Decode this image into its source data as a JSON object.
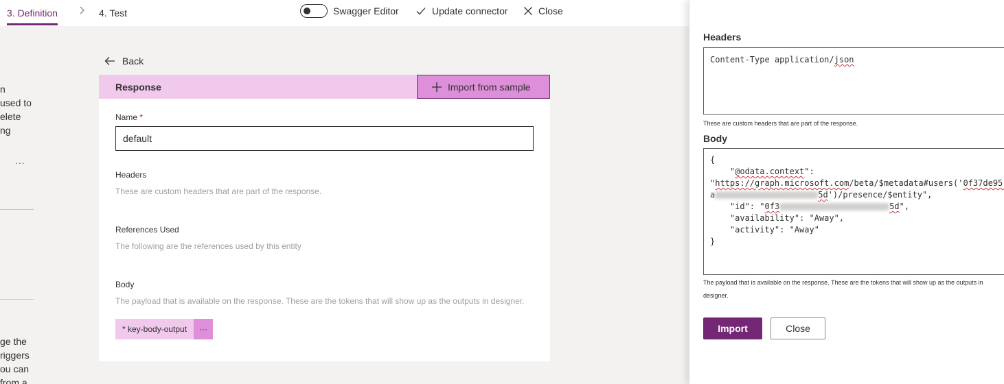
{
  "steps": {
    "active_label": "3. Definition",
    "next_label": "4. Test"
  },
  "toolbar": {
    "swagger_label": "Swagger Editor",
    "update_label": "Update connector",
    "close_label": "Close"
  },
  "sidebar": {
    "fragments": [
      "n",
      "used to",
      "elete",
      "ng",
      "ge the",
      "riggers",
      "ou can",
      "from a"
    ],
    "more_label": "..."
  },
  "back_label": "Back",
  "response_card": {
    "title": "Response",
    "import_label": "Import from sample",
    "name_label": "Name",
    "required_marker": "*",
    "name_value": "default",
    "headers_label": "Headers",
    "headers_help": "These are custom headers that are part of the response.",
    "references_label": "References Used",
    "references_help": "The following are the references used by this entity",
    "body_label": "Body",
    "body_help": "The payload that is available on the response. These are the tokens that will show up as the outputs in designer.",
    "token_label": "* key-body-output",
    "token_more": "···"
  },
  "panel": {
    "headers_label": "Headers",
    "headers_value_prefix": "Content-Type application/",
    "headers_value_json": "json",
    "headers_help": "These are custom headers that are part of the response.",
    "body_label": "Body",
    "body_lines": {
      "l1": "{",
      "l2_pre": "    \"",
      "l2_key": "@odata.context",
      "l2_post": "\":",
      "l3_pre": "\"",
      "l3_url": "https://graph.microsoft.com",
      "l3_mid": "/beta/$metadata#users('",
      "l3_id": "0f37de95-",
      "l4_a": "a",
      "l4_end": "5d",
      "l4_post": "')/presence/$entity\",",
      "l5_pre": "    \"id\": \"",
      "l5_id": "0f3",
      "l5_end": "5d",
      "l5_post": "\",",
      "l6": "    \"availability\": \"Away\",",
      "l7": "    \"activity\": \"Away\"",
      "l8": "}"
    },
    "body_help_line1": "The payload that is available on the response. These are the tokens that will show up as the outputs in",
    "body_help_line2": "designer.",
    "import_button": "Import",
    "close_button": "Close"
  },
  "colors": {
    "accent": "#742774",
    "accent_light": "#f0c9ec",
    "accent_mid": "#dd8fd9"
  }
}
